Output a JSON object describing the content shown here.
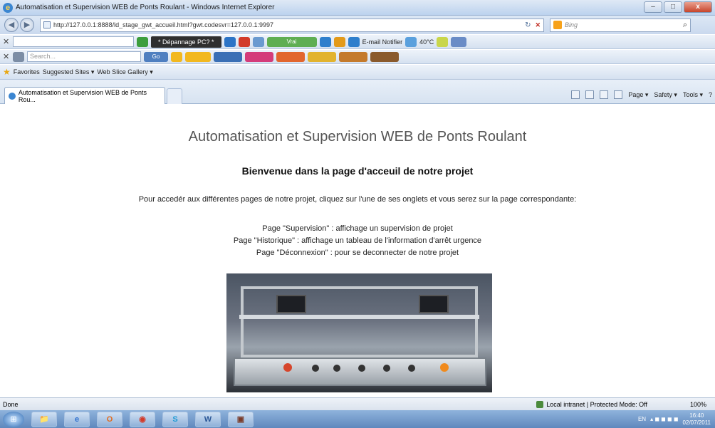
{
  "window": {
    "title": "Automatisation et Supervision WEB de Ponts Roulant - Windows Internet Explorer",
    "minimize_icon": "–",
    "maximize_icon": "□",
    "close_icon": "x"
  },
  "address": {
    "url": "http://127.0.0.1:8888/ld_stage_gwt_accueil.html?gwt.codesvr=127.0.0.1:9997",
    "search_placeholder": "Bing",
    "back_icon": "◀",
    "forward_icon": "▶",
    "refresh_icon": "↻",
    "stop_icon": "✕",
    "search_go_icon": "⌕"
  },
  "toolbar1": {
    "close_icon": "✕",
    "button_depannage": "* Dépannage PC? *",
    "chip_vrai": "Vrai",
    "email_notifier": "E-mail Notifier",
    "temperature": "40°C"
  },
  "toolbar2": {
    "close_icon": "✕",
    "search_placeholder": "Search...",
    "go_label": "Go"
  },
  "toolbar3": {
    "favorites": "Favorites",
    "suggested_sites": "Suggested Sites ▾",
    "web_slice_gallery": "Web Slice Gallery ▾",
    "star_icon": "★"
  },
  "tabs": {
    "active_tab": "Automatisation et Supervision WEB de Ponts Rou...",
    "page_menu": "Page ▾",
    "safety_menu": "Safety ▾",
    "tools_menu": "Tools ▾",
    "help_icon": "?"
  },
  "page": {
    "title": "Automatisation et Supervision WEB de Ponts Roulant",
    "subtitle": "Bienvenue dans la page d'acceuil de notre projet",
    "intro": "Pour accedér aux différentes pages de notre projet, cliquez sur l'une de ses onglets et vous serez sur la page correspondante:",
    "lines": [
      "Page \"Supervision\" : affichage un supervision de projet",
      "Page \"Historique\" : affichage un tableau de l'information d'arrêt urgence",
      "Page \"Déconnexion\" : pour se deconnecter de notre projet"
    ]
  },
  "status": {
    "text": "Done",
    "zone": "Local intranet | Protected Mode: Off",
    "zoom": "100%"
  },
  "taskbar": {
    "start_icon": "⊞",
    "items": [
      "📁",
      "e",
      "O",
      "◉",
      "S",
      "W",
      "▣"
    ],
    "language": "EN",
    "time": "16:40",
    "date": "02/07/2011"
  }
}
